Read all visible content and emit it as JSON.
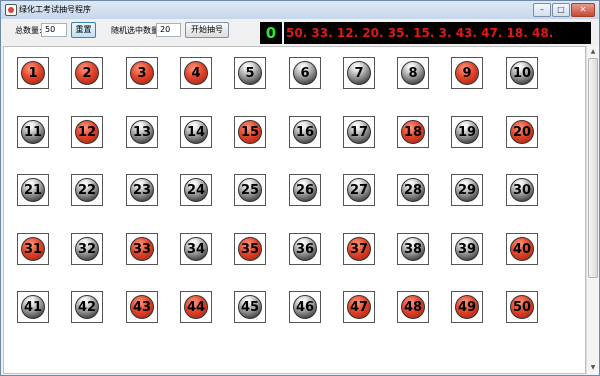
{
  "window": {
    "title": "绿化工考试抽号程序",
    "buttons": [
      "minimize",
      "maximize",
      "close"
    ]
  },
  "toolbar": {
    "total_label": "总数量:",
    "total_value": "50",
    "reset_label": "重置",
    "random_label": "随机选中数量:",
    "random_value": "20",
    "start_label": "开始抽号"
  },
  "counter": {
    "value": "0",
    "color": "#2ce82c"
  },
  "drawn": {
    "text": "50. 33. 12. 20. 35. 15. 3. 43. 47. 18. 48.",
    "color": "#e01818"
  },
  "balls": [
    {
      "n": "1",
      "red": true
    },
    {
      "n": "2",
      "red": true
    },
    {
      "n": "3",
      "red": true
    },
    {
      "n": "4",
      "red": true
    },
    {
      "n": "5",
      "red": false
    },
    {
      "n": "6",
      "red": false
    },
    {
      "n": "7",
      "red": false
    },
    {
      "n": "8",
      "red": false
    },
    {
      "n": "9",
      "red": true
    },
    {
      "n": "10",
      "red": false
    },
    {
      "n": "11",
      "red": false
    },
    {
      "n": "12",
      "red": true
    },
    {
      "n": "13",
      "red": false
    },
    {
      "n": "14",
      "red": false
    },
    {
      "n": "15",
      "red": true
    },
    {
      "n": "16",
      "red": false
    },
    {
      "n": "17",
      "red": false
    },
    {
      "n": "18",
      "red": true
    },
    {
      "n": "19",
      "red": false
    },
    {
      "n": "20",
      "red": true
    },
    {
      "n": "21",
      "red": false
    },
    {
      "n": "22",
      "red": false
    },
    {
      "n": "23",
      "red": false
    },
    {
      "n": "24",
      "red": false
    },
    {
      "n": "25",
      "red": false
    },
    {
      "n": "26",
      "red": false
    },
    {
      "n": "27",
      "red": false
    },
    {
      "n": "28",
      "red": false
    },
    {
      "n": "29",
      "red": false
    },
    {
      "n": "30",
      "red": false
    },
    {
      "n": "31",
      "red": true
    },
    {
      "n": "32",
      "red": false
    },
    {
      "n": "33",
      "red": true
    },
    {
      "n": "34",
      "red": false
    },
    {
      "n": "35",
      "red": true
    },
    {
      "n": "36",
      "red": false
    },
    {
      "n": "37",
      "red": true
    },
    {
      "n": "38",
      "red": false
    },
    {
      "n": "39",
      "red": false
    },
    {
      "n": "40",
      "red": true
    },
    {
      "n": "41",
      "red": false
    },
    {
      "n": "42",
      "red": false
    },
    {
      "n": "43",
      "red": true
    },
    {
      "n": "44",
      "red": true
    },
    {
      "n": "45",
      "red": false
    },
    {
      "n": "46",
      "red": false
    },
    {
      "n": "47",
      "red": true
    },
    {
      "n": "48",
      "red": true
    },
    {
      "n": "49",
      "red": true
    },
    {
      "n": "50",
      "red": true
    }
  ],
  "colors": {
    "selected_ball": "#e3452a",
    "unselected_ball": "#151515"
  },
  "icons": [
    "app-icon",
    "minimize-icon",
    "maximize-icon",
    "close-icon",
    "scroll-up-icon",
    "scroll-down-icon"
  ]
}
